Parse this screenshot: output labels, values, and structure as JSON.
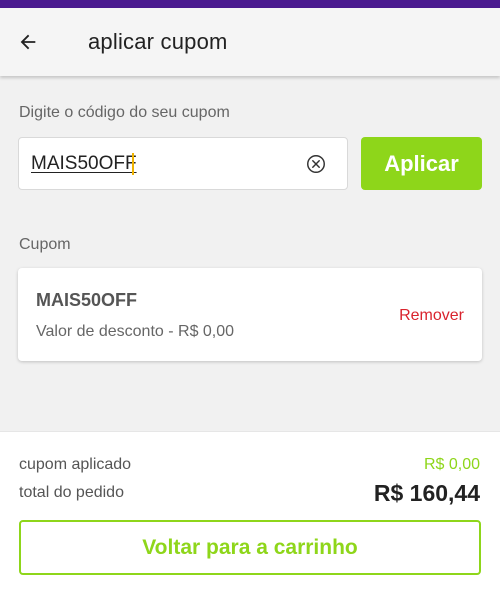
{
  "header": {
    "title": "aplicar cupom",
    "back_icon": "arrow-left-icon"
  },
  "coupon_entry": {
    "prompt": "Digite o código do seu cupom",
    "input_value": "MAIS50OFF",
    "clear_icon": "clear-circle-x-icon",
    "apply_label": "Aplicar"
  },
  "applied_section": {
    "label": "Cupom",
    "card": {
      "code": "MAIS50OFF",
      "discount_text": "Valor de desconto - R$ 0,00",
      "remove_label": "Remover"
    }
  },
  "summary": {
    "applied_label": "cupom aplicado",
    "applied_value": "R$ 0,00",
    "total_label": "total do pedido",
    "total_value": "R$ 160,44",
    "back_button_label": "Voltar para a carrinho"
  },
  "colors": {
    "status_bar": "#4a1a8f",
    "accent_green": "#8ed61a",
    "remove_red": "#d9232d"
  }
}
